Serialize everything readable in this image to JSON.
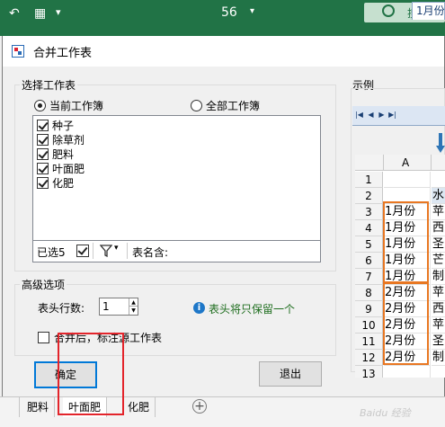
{
  "excel": {
    "zoom_value": "56",
    "search_label": "搜索",
    "sheet_tabs": [
      "肥料",
      "叶面肥",
      "化肥"
    ]
  },
  "dialog": {
    "title": "合并工作表",
    "select_group": {
      "label": "选择工作表",
      "radio_current": "当前工作簿",
      "radio_all": "全部工作簿",
      "selected_radio": "current",
      "items": [
        {
          "label": "种子",
          "checked": true
        },
        {
          "label": "除草剂",
          "checked": true
        },
        {
          "label": "肥料",
          "checked": true
        },
        {
          "label": "叶面肥",
          "checked": true
        },
        {
          "label": "化肥",
          "checked": true
        }
      ],
      "selected_count": "已选5",
      "sheetname_contains_label": "表名含:",
      "sheetname_contains_value": ""
    },
    "advanced_group": {
      "label": "高级选项",
      "header_rows_label": "表头行数:",
      "header_rows_value": "1",
      "info_text": "表头将只保留一个",
      "mark_source_label": "合并后，标注源工作表",
      "mark_source_checked": false
    },
    "ok_label": "确定",
    "exit_label": "退出"
  },
  "example": {
    "label": "示例",
    "tab_label": "1月份",
    "column_header": "A",
    "row_numbers": [
      "1",
      "2",
      "3",
      "4",
      "5",
      "6",
      "7",
      "8",
      "9",
      "10",
      "11",
      "12",
      "13"
    ],
    "col_a": [
      "",
      "",
      "1月份",
      "1月份",
      "1月份",
      "1月份",
      "1月份",
      "2月份",
      "2月份",
      "2月份",
      "2月份",
      "2月份",
      ""
    ],
    "col_b": [
      "",
      "水",
      "苹",
      "西",
      "圣",
      "芒",
      "制",
      "苹",
      "西",
      "苹",
      "圣",
      "制",
      ""
    ]
  },
  "colors": {
    "excel_green": "#217346",
    "highlight_orange": "#e87722",
    "highlight_red": "#e3242b",
    "info_blue": "#1e77c8"
  }
}
